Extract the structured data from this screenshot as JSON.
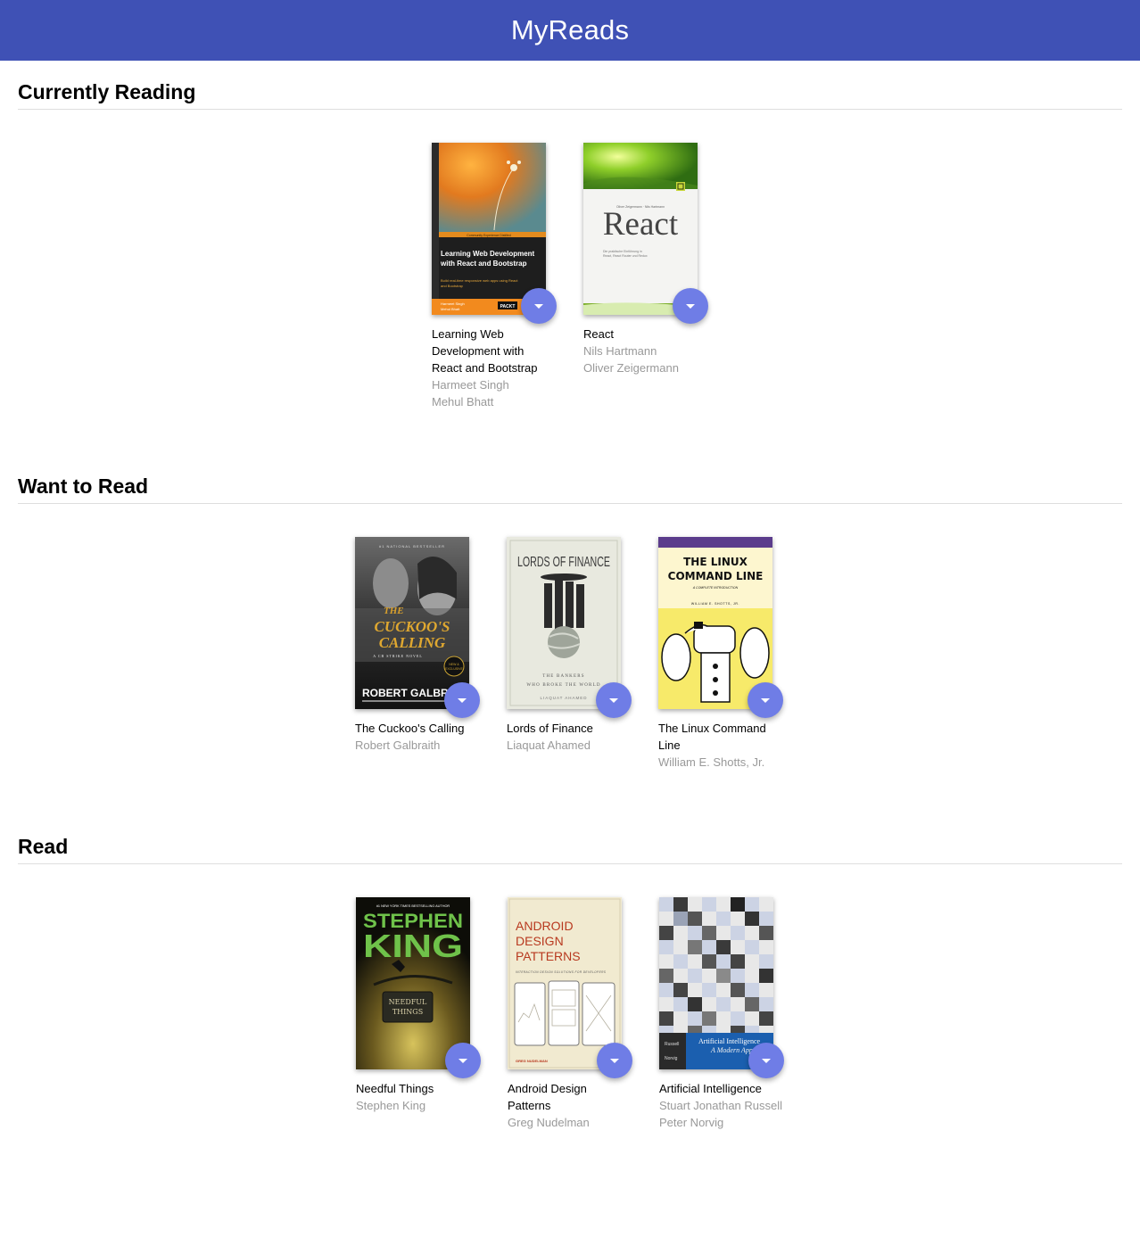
{
  "app": {
    "title": "MyReads"
  },
  "shelves": [
    {
      "title": "Currently Reading",
      "books": [
        {
          "title": "Learning Web Development with React and Bootstrap",
          "authors": [
            "Harmeet Singh",
            "Mehul Bhatt"
          ],
          "cover": {
            "heading": "Learning Web Development with React and Bootstrap",
            "tagline": "Build real-time responsive web apps using React and Bootstrap",
            "band": "Community  Experience  Distilled",
            "authors": "Harmeet Singh\nMehul Bhatt",
            "publisher": "PACKT"
          }
        },
        {
          "title": "React",
          "authors": [
            "Nils Hartmann",
            "Oliver Zeigermann"
          ],
          "cover": {
            "heading": "React",
            "byline": "Oliver Zeigermann · Nils Hartmann",
            "subtitle": "Die praktische Einführung in React, React Router und Redux"
          }
        }
      ]
    },
    {
      "title": "Want to Read",
      "books": [
        {
          "title": "The Cuckoo's Calling",
          "authors": [
            "Robert Galbraith"
          ],
          "cover": {
            "kicker": "#1 NATIONAL BESTSELLER",
            "line1": "THE",
            "line2": "CUCKOO'S",
            "line3": "CALLING",
            "series": "A CB STRIKE NOVEL",
            "author": "ROBERT GALBRAITH"
          }
        },
        {
          "title": "Lords of Finance",
          "authors": [
            "Liaquat Ahamed"
          ],
          "cover": {
            "heading": "LORDS OF FINANCE",
            "sub1": "THE BANKERS",
            "sub2": "WHO BROKE THE WORLD",
            "author": "LIAQUAT AHAMED"
          }
        },
        {
          "title": "The Linux Command Line",
          "authors": [
            "William E. Shotts, Jr."
          ],
          "cover": {
            "line1": "THE LINUX",
            "line2": "COMMAND LINE",
            "sub": "A COMPLETE INTRODUCTION",
            "author": "WILLIAM E. SHOTTS, JR."
          }
        }
      ]
    },
    {
      "title": "Read",
      "books": [
        {
          "title": "Needful Things",
          "authors": [
            "Stephen King"
          ],
          "cover": {
            "kicker": "#1 NEW YORK TIMES BESTSELLING AUTHOR",
            "line1": "STEPHEN",
            "line2": "KING",
            "sign1": "NEEDFUL",
            "sign2": "THINGS"
          }
        },
        {
          "title": "Android Design Patterns",
          "authors": [
            "Greg Nudelman"
          ],
          "cover": {
            "line1": "ANDROID",
            "line2": "DESIGN",
            "line3": "PATTERNS",
            "sub": "INTERACTION DESIGN SOLUTIONS FOR DEVELOPERS",
            "author": "GREG NUDELMAN"
          }
        },
        {
          "title": "Artificial Intelligence",
          "authors": [
            "Stuart Jonathan Russell",
            "Peter Norvig"
          ],
          "cover": {
            "line1": "Artificial Intelligence",
            "line2": "A Modern App",
            "authorA": "Russell",
            "authorB": "Norvig"
          }
        }
      ]
    }
  ]
}
